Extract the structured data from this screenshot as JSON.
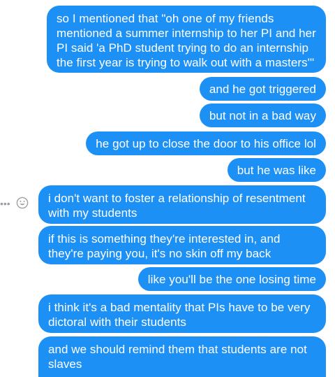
{
  "colors": {
    "bubble": "#1d90f5",
    "bubble_text": "#ffffff",
    "icon_gray": "#9aa0a6"
  },
  "messages": [
    {
      "text": "so I mentioned that \"oh one of my friends mentioned a summer internship to her PI and her PI said 'a PhD student trying to do an internship the first year is trying to walk out with a masters'\""
    },
    {
      "text": "and he got triggered"
    },
    {
      "text": "but not in a bad way"
    },
    {
      "text": "he got up to close the door to his office lol"
    },
    {
      "text": "but he was like"
    },
    {
      "text": "i don't want to foster a relationship of resentment with my students"
    },
    {
      "text": "if this is something they're interested in, and they're paying you, it's no skin off my back"
    },
    {
      "text": "like you'll be the one losing time"
    },
    {
      "text": "i think it's a bad mentality that PIs have to be very dictoral with their students"
    },
    {
      "text": "and we should remind them that students are not slaves"
    }
  ],
  "reactions": {
    "more_icon": "more-options-icon",
    "more_glyph": "•••",
    "emoji_icon": "smiley-face-icon"
  }
}
